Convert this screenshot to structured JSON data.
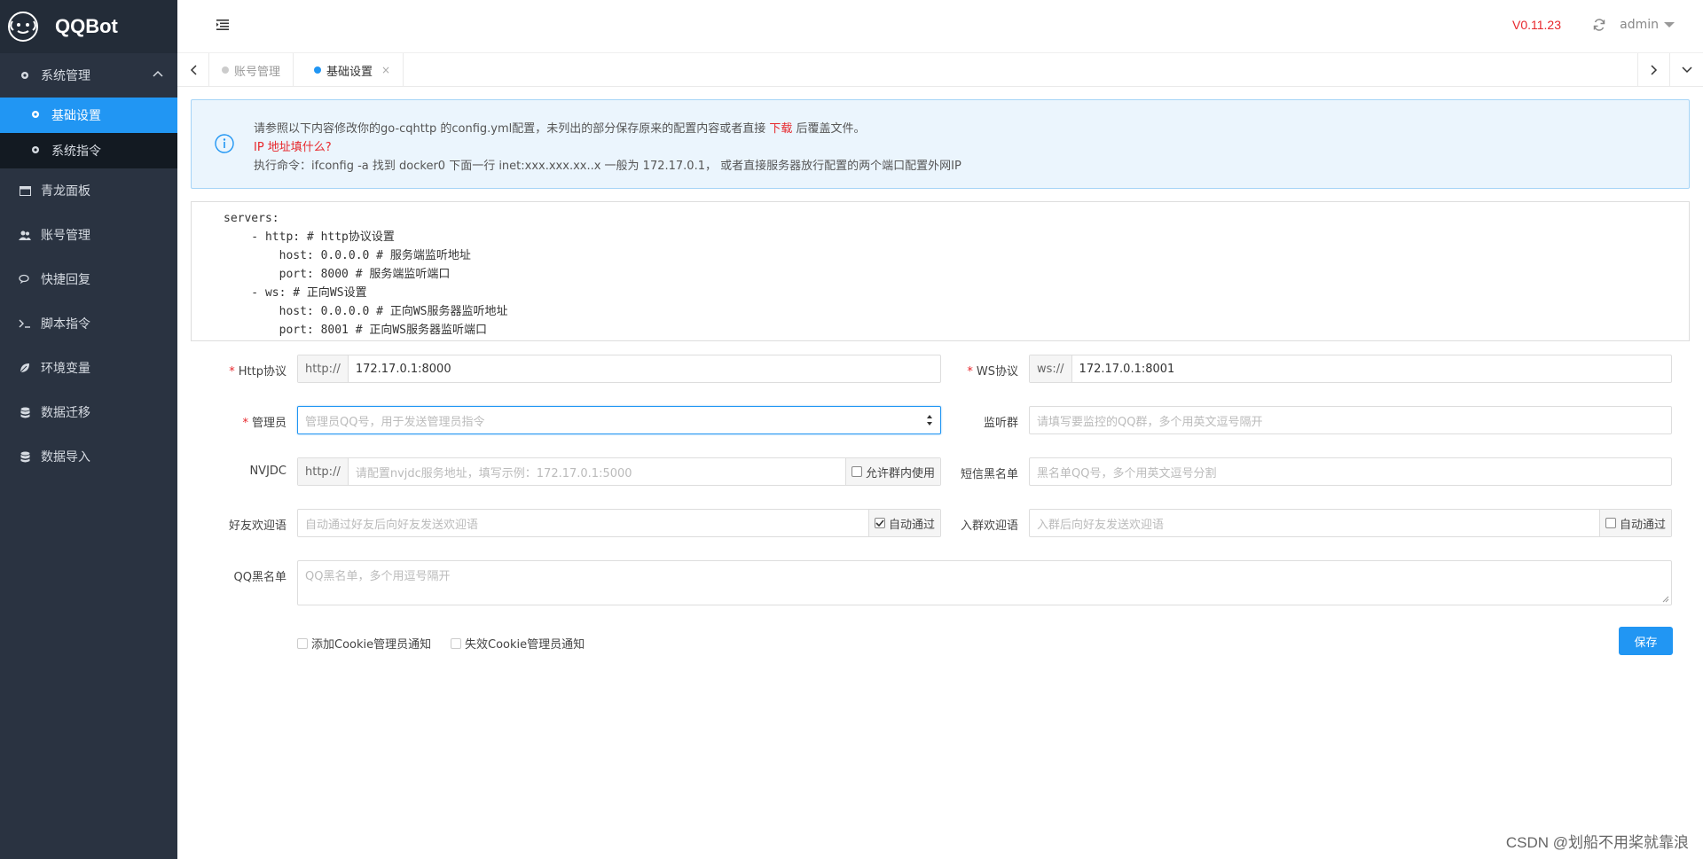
{
  "app": {
    "name": "QQBot",
    "version": "V0.11.23",
    "user": "admin"
  },
  "sidebar": {
    "group": "系统管理",
    "sub_items": [
      {
        "label": "基础设置",
        "active": true
      },
      {
        "label": "系统指令",
        "active": false
      }
    ],
    "items": [
      {
        "label": "青龙面板",
        "icon": "window-icon"
      },
      {
        "label": "账号管理",
        "icon": "users-icon"
      },
      {
        "label": "快捷回复",
        "icon": "chat-icon"
      },
      {
        "label": "脚本指令",
        "icon": "terminal-icon"
      },
      {
        "label": "环境变量",
        "icon": "leaf-icon"
      },
      {
        "label": "数据迁移",
        "icon": "database-icon"
      },
      {
        "label": "数据导入",
        "icon": "database-icon"
      }
    ]
  },
  "tabs": [
    {
      "label": "账号管理",
      "active": false
    },
    {
      "label": "基础设置",
      "active": true,
      "close": "×"
    }
  ],
  "alert": {
    "line1_a": "请参照以下内容修改你的go-cqhttp 的config.yml配置，未列出的部分保存原来的配置内容或者直接 ",
    "line1_link": "下载",
    "line1_b": " 后覆盖文件。",
    "line2": "IP 地址填什么?",
    "line3": "执行命令：ifconfig -a 找到 docker0 下面一行 inet:xxx.xxx.xx..x 一般为 172.17.0.1， 或者直接服务器放行配置的两个端口配置外网IP"
  },
  "config_code": [
    "servers:",
    "    - http: # http协议设置",
    "        host: 0.0.0.0 # 服务端监听地址",
    "        port: 8000 # 服务端监听端口",
    "    - ws: # 正向WS设置",
    "        host: 0.0.0.0 # 正向WS服务器监听地址",
    "        port: 8001 # 正向WS服务器监听端口"
  ],
  "form": {
    "http": {
      "label": "Http协议",
      "prefix": "http://",
      "value": "172.17.0.1:8000"
    },
    "ws": {
      "label": "WS协议",
      "prefix": "ws://",
      "value": "172.17.0.1:8001"
    },
    "admin": {
      "label": "管理员",
      "placeholder": "管理员QQ号，用于发送管理员指令"
    },
    "listen_group": {
      "label": "监听群",
      "placeholder": "请填写要监控的QQ群，多个用英文逗号隔开"
    },
    "nvjdc": {
      "label": "NVJDC",
      "prefix": "http://",
      "placeholder": "请配置nvjdc服务地址，填写示例：172.17.0.1:5000",
      "suffix": "允许群内使用",
      "checked": false
    },
    "sms_blacklist": {
      "label": "短信黑名单",
      "placeholder": "黑名单QQ号，多个用英文逗号分割"
    },
    "friend_welcome": {
      "label": "好友欢迎语",
      "placeholder": "自动通过好友后向好友发送欢迎语",
      "suffix": "自动通过",
      "checked": true
    },
    "group_welcome": {
      "label": "入群欢迎语",
      "placeholder": "入群后向好友发送欢迎语",
      "suffix": "自动通过",
      "checked": false
    },
    "qq_blacklist": {
      "label": "QQ黑名单",
      "placeholder": "QQ黑名单，多个用逗号隔开"
    },
    "notify_add": "添加Cookie管理员通知",
    "notify_expire": "失效Cookie管理员通知",
    "save": "保存"
  },
  "watermark": "CSDN @划船不用桨就靠浪"
}
